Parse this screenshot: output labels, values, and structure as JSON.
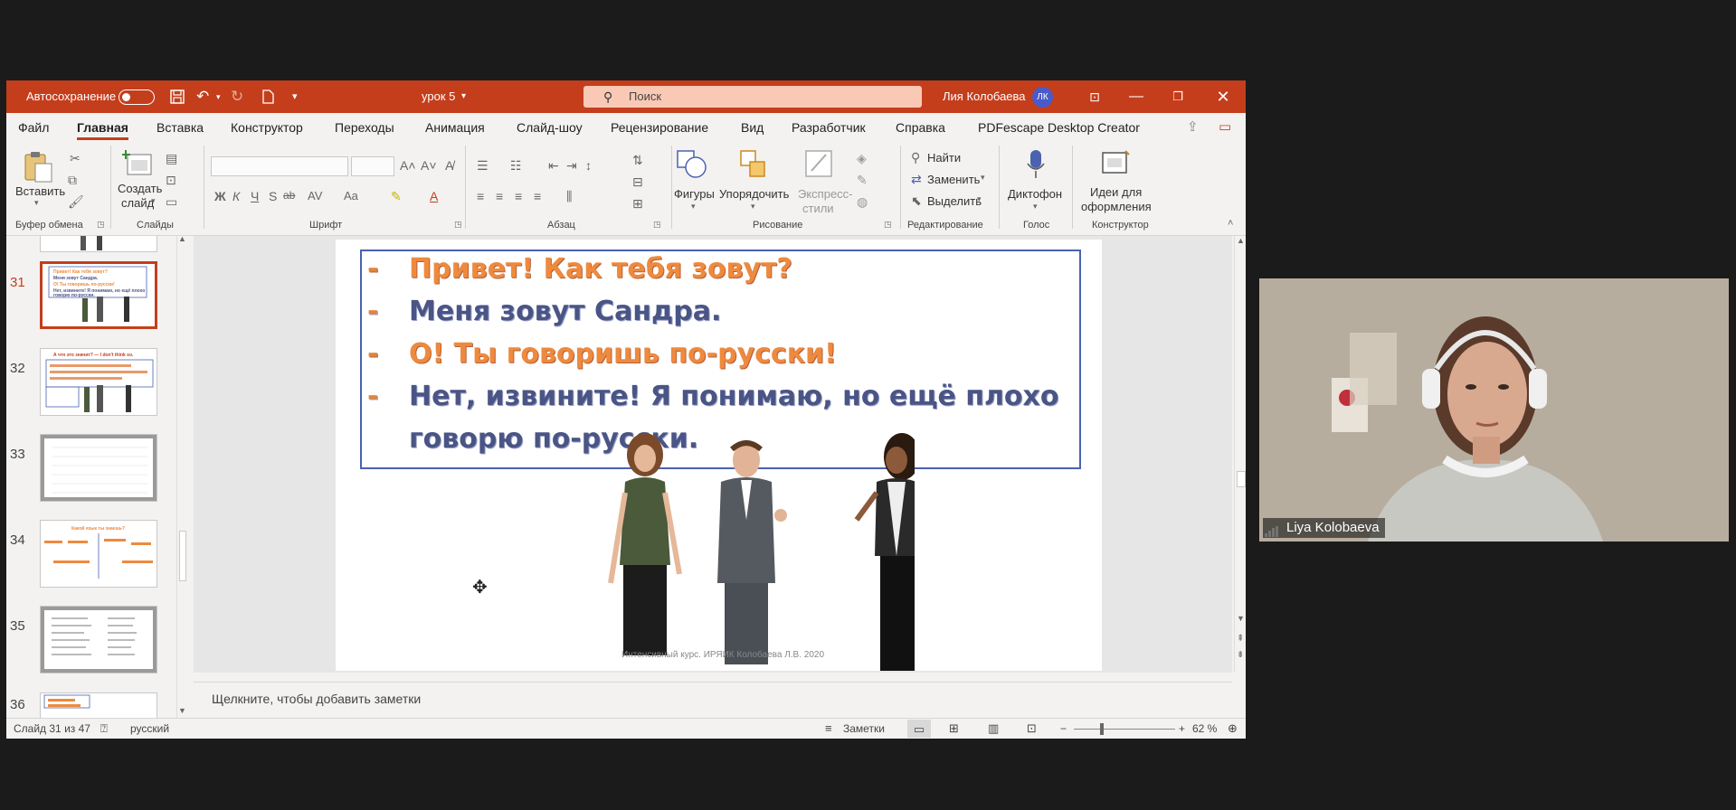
{
  "titlebar": {
    "autosave_label": "Автосохранение",
    "file_name": "урок 5",
    "search_placeholder": "Поиск",
    "user_name": "Лия Колобаева",
    "user_initials": "ЛК"
  },
  "tabs": [
    "Файл",
    "Главная",
    "Вставка",
    "Конструктор",
    "Переходы",
    "Анимация",
    "Слайд-шоу",
    "Рецензирование",
    "Вид",
    "Разработчик",
    "Справка",
    "PDFescape Desktop Creator"
  ],
  "ribbon": {
    "paste": "Вставить",
    "create_slide_1": "Создать",
    "create_slide_2": "слайд",
    "shapes": "Фигуры",
    "arrange": "Упорядочить",
    "express_1": "Экспресс-",
    "express_2": "стили",
    "find": "Найти",
    "replace": "Заменить",
    "select": "Выделить",
    "dictate": "Диктофон",
    "ideas_1": "Идеи для",
    "ideas_2": "оформления",
    "font_buttons": [
      "Ж",
      "К",
      "Ч",
      "S",
      "ab",
      "AV",
      "Aa"
    ],
    "groups": [
      "Буфер обмена",
      "Слайды",
      "Шрифт",
      "Абзац",
      "Рисование",
      "Редактирование",
      "Голос",
      "Конструктор"
    ]
  },
  "thumbnails": {
    "numbers": [
      "31",
      "32",
      "33",
      "34",
      "35",
      "36"
    ],
    "t31_lines": [
      "Привет! Как тебя зовут?",
      "Меня зовут Сандра.",
      "О! Ты говоришь по-русски!",
      "Нет, извините! Я понимаю, но ещё плохо",
      "говорю по-русски."
    ],
    "t32_title": "А что это значит? — I don't think so.",
    "t34_title": "Какой язык ты знаешь?"
  },
  "slide": {
    "dash": "-",
    "line1": "Привет! Как тебя зовут?",
    "line2": "Меня зовут Сандра.",
    "line3": "О! Ты говоришь по-русски!",
    "line4a": "Нет, извините! Я понимаю, но ещё плохо",
    "line4b": "говорю по-русски.",
    "footnote": "Интенсивный курс. ИРЯИК Колобаева Л.В. 2020"
  },
  "notes_placeholder": "Щелкните, чтобы добавить заметки",
  "status": {
    "slide_info": "Слайд 31 из 47",
    "language": "русский",
    "notes_button": "Заметки",
    "zoom": "62 %"
  },
  "video": {
    "participant": "Liya Kolobaeva"
  },
  "colors": {
    "ppt_accent": "#c43e1c",
    "slide_orange": "#ee8a3e",
    "slide_navy": "#4a5586"
  }
}
